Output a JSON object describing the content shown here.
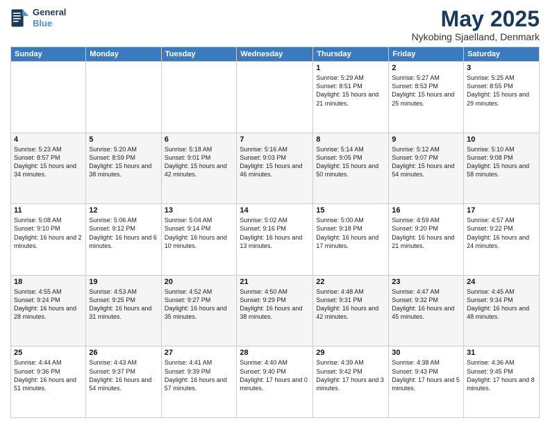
{
  "logo": {
    "line1": "General",
    "line2": "Blue"
  },
  "title": "May 2025",
  "subtitle": "Nykobing Sjaelland, Denmark",
  "weekdays": [
    "Sunday",
    "Monday",
    "Tuesday",
    "Wednesday",
    "Thursday",
    "Friday",
    "Saturday"
  ],
  "weeks": [
    [
      {
        "day": "",
        "sunrise": "",
        "sunset": "",
        "daylight": ""
      },
      {
        "day": "",
        "sunrise": "",
        "sunset": "",
        "daylight": ""
      },
      {
        "day": "",
        "sunrise": "",
        "sunset": "",
        "daylight": ""
      },
      {
        "day": "",
        "sunrise": "",
        "sunset": "",
        "daylight": ""
      },
      {
        "day": "1",
        "sunrise": "Sunrise: 5:29 AM",
        "sunset": "Sunset: 8:51 PM",
        "daylight": "Daylight: 15 hours and 21 minutes."
      },
      {
        "day": "2",
        "sunrise": "Sunrise: 5:27 AM",
        "sunset": "Sunset: 8:53 PM",
        "daylight": "Daylight: 15 hours and 25 minutes."
      },
      {
        "day": "3",
        "sunrise": "Sunrise: 5:25 AM",
        "sunset": "Sunset: 8:55 PM",
        "daylight": "Daylight: 15 hours and 29 minutes."
      }
    ],
    [
      {
        "day": "4",
        "sunrise": "Sunrise: 5:23 AM",
        "sunset": "Sunset: 8:57 PM",
        "daylight": "Daylight: 15 hours and 34 minutes."
      },
      {
        "day": "5",
        "sunrise": "Sunrise: 5:20 AM",
        "sunset": "Sunset: 8:59 PM",
        "daylight": "Daylight: 15 hours and 38 minutes."
      },
      {
        "day": "6",
        "sunrise": "Sunrise: 5:18 AM",
        "sunset": "Sunset: 9:01 PM",
        "daylight": "Daylight: 15 hours and 42 minutes."
      },
      {
        "day": "7",
        "sunrise": "Sunrise: 5:16 AM",
        "sunset": "Sunset: 9:03 PM",
        "daylight": "Daylight: 15 hours and 46 minutes."
      },
      {
        "day": "8",
        "sunrise": "Sunrise: 5:14 AM",
        "sunset": "Sunset: 9:05 PM",
        "daylight": "Daylight: 15 hours and 50 minutes."
      },
      {
        "day": "9",
        "sunrise": "Sunrise: 5:12 AM",
        "sunset": "Sunset: 9:07 PM",
        "daylight": "Daylight: 15 hours and 54 minutes."
      },
      {
        "day": "10",
        "sunrise": "Sunrise: 5:10 AM",
        "sunset": "Sunset: 9:08 PM",
        "daylight": "Daylight: 15 hours and 58 minutes."
      }
    ],
    [
      {
        "day": "11",
        "sunrise": "Sunrise: 5:08 AM",
        "sunset": "Sunset: 9:10 PM",
        "daylight": "Daylight: 16 hours and 2 minutes."
      },
      {
        "day": "12",
        "sunrise": "Sunrise: 5:06 AM",
        "sunset": "Sunset: 9:12 PM",
        "daylight": "Daylight: 16 hours and 6 minutes."
      },
      {
        "day": "13",
        "sunrise": "Sunrise: 5:04 AM",
        "sunset": "Sunset: 9:14 PM",
        "daylight": "Daylight: 16 hours and 10 minutes."
      },
      {
        "day": "14",
        "sunrise": "Sunrise: 5:02 AM",
        "sunset": "Sunset: 9:16 PM",
        "daylight": "Daylight: 16 hours and 13 minutes."
      },
      {
        "day": "15",
        "sunrise": "Sunrise: 5:00 AM",
        "sunset": "Sunset: 9:18 PM",
        "daylight": "Daylight: 16 hours and 17 minutes."
      },
      {
        "day": "16",
        "sunrise": "Sunrise: 4:59 AM",
        "sunset": "Sunset: 9:20 PM",
        "daylight": "Daylight: 16 hours and 21 minutes."
      },
      {
        "day": "17",
        "sunrise": "Sunrise: 4:57 AM",
        "sunset": "Sunset: 9:22 PM",
        "daylight": "Daylight: 16 hours and 24 minutes."
      }
    ],
    [
      {
        "day": "18",
        "sunrise": "Sunrise: 4:55 AM",
        "sunset": "Sunset: 9:24 PM",
        "daylight": "Daylight: 16 hours and 28 minutes."
      },
      {
        "day": "19",
        "sunrise": "Sunrise: 4:53 AM",
        "sunset": "Sunset: 9:25 PM",
        "daylight": "Daylight: 16 hours and 31 minutes."
      },
      {
        "day": "20",
        "sunrise": "Sunrise: 4:52 AM",
        "sunset": "Sunset: 9:27 PM",
        "daylight": "Daylight: 16 hours and 35 minutes."
      },
      {
        "day": "21",
        "sunrise": "Sunrise: 4:50 AM",
        "sunset": "Sunset: 9:29 PM",
        "daylight": "Daylight: 16 hours and 38 minutes."
      },
      {
        "day": "22",
        "sunrise": "Sunrise: 4:48 AM",
        "sunset": "Sunset: 9:31 PM",
        "daylight": "Daylight: 16 hours and 42 minutes."
      },
      {
        "day": "23",
        "sunrise": "Sunrise: 4:47 AM",
        "sunset": "Sunset: 9:32 PM",
        "daylight": "Daylight: 16 hours and 45 minutes."
      },
      {
        "day": "24",
        "sunrise": "Sunrise: 4:45 AM",
        "sunset": "Sunset: 9:34 PM",
        "daylight": "Daylight: 16 hours and 48 minutes."
      }
    ],
    [
      {
        "day": "25",
        "sunrise": "Sunrise: 4:44 AM",
        "sunset": "Sunset: 9:36 PM",
        "daylight": "Daylight: 16 hours and 51 minutes."
      },
      {
        "day": "26",
        "sunrise": "Sunrise: 4:43 AM",
        "sunset": "Sunset: 9:37 PM",
        "daylight": "Daylight: 16 hours and 54 minutes."
      },
      {
        "day": "27",
        "sunrise": "Sunrise: 4:41 AM",
        "sunset": "Sunset: 9:39 PM",
        "daylight": "Daylight: 16 hours and 57 minutes."
      },
      {
        "day": "28",
        "sunrise": "Sunrise: 4:40 AM",
        "sunset": "Sunset: 9:40 PM",
        "daylight": "Daylight: 17 hours and 0 minutes."
      },
      {
        "day": "29",
        "sunrise": "Sunrise: 4:39 AM",
        "sunset": "Sunset: 9:42 PM",
        "daylight": "Daylight: 17 hours and 3 minutes."
      },
      {
        "day": "30",
        "sunrise": "Sunrise: 4:38 AM",
        "sunset": "Sunset: 9:43 PM",
        "daylight": "Daylight: 17 hours and 5 minutes."
      },
      {
        "day": "31",
        "sunrise": "Sunrise: 4:36 AM",
        "sunset": "Sunset: 9:45 PM",
        "daylight": "Daylight: 17 hours and 8 minutes."
      }
    ]
  ]
}
